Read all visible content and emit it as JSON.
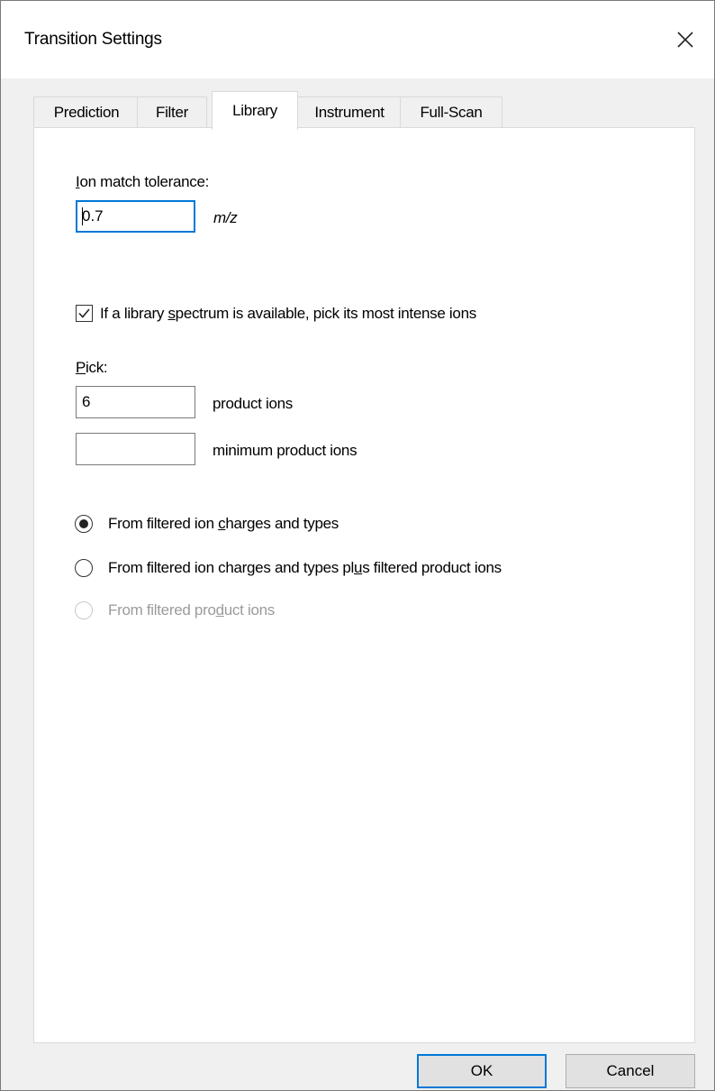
{
  "window": {
    "title": "Transition Settings",
    "close_icon": "close-icon"
  },
  "tabs": [
    {
      "label": "Prediction",
      "active": false
    },
    {
      "label": "Filter",
      "active": false
    },
    {
      "label": "Library",
      "active": true
    },
    {
      "label": "Instrument",
      "active": false
    },
    {
      "label": "Full-Scan",
      "active": false
    }
  ],
  "library": {
    "tolerance_label_prefix": "I",
    "tolerance_label_rest": "on match tolerance:",
    "tolerance_value": "0.7",
    "tolerance_unit": "m/z",
    "pick_checkbox": {
      "checked": true,
      "label_pre": "If a library ",
      "label_access": "s",
      "label_post": "pectrum is available, pick its most intense ions"
    },
    "pick_label_access": "P",
    "pick_label_rest": "ick:",
    "product_ions_value": "6",
    "product_ions_label": "product ions",
    "min_product_ions_value": "",
    "min_product_ions_label": "minimum product ions",
    "radios": [
      {
        "pre": "From filtered ion ",
        "access": "c",
        "post": "harges and types",
        "checked": true,
        "enabled": true
      },
      {
        "pre": "From filtered ion charges and types pl",
        "access": "u",
        "post": "s filtered product ions",
        "checked": false,
        "enabled": true
      },
      {
        "pre": "From filtered pro",
        "access": "d",
        "post": "uct ions",
        "checked": false,
        "enabled": false
      }
    ]
  },
  "buttons": {
    "ok_label": "OK",
    "cancel_label": "Cancel"
  },
  "colors": {
    "focus_accent": "#0078d7",
    "dialog_background": "#f0f0f0",
    "disabled_text": "#9b9b9b"
  }
}
